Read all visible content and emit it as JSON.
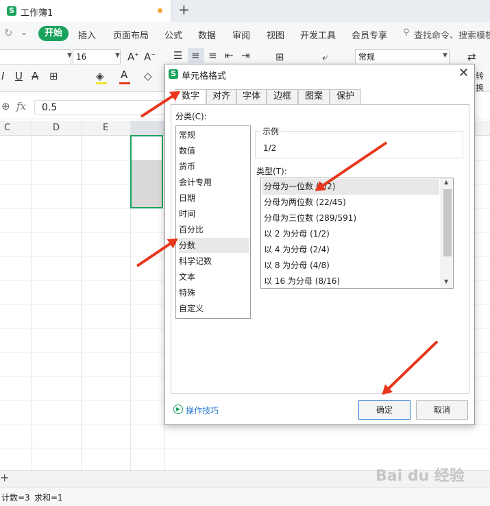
{
  "app": {
    "doc_title": "工作簿1",
    "logo_letter": "S"
  },
  "menu": {
    "start": "开始",
    "items": [
      "插入",
      "页面布局",
      "公式",
      "数据",
      "审阅",
      "视图",
      "开发工具",
      "会员专享"
    ],
    "search_placeholder": "查找命令、搜索模板"
  },
  "ribbon": {
    "font_size": "16",
    "number_format": "常规",
    "convert_label": "转换"
  },
  "formula_bar": {
    "fx": "fx",
    "value": "0.5"
  },
  "sheet": {
    "columns": [
      "C",
      "D",
      "E"
    ]
  },
  "status": {
    "count_label": "计数=3",
    "sum_label": "求和=1"
  },
  "dialog": {
    "title": "单元格格式",
    "tabs": [
      "数字",
      "对齐",
      "字体",
      "边框",
      "图案",
      "保护"
    ],
    "active_tab": "数字",
    "category_label": "分类(C):",
    "categories": [
      "常规",
      "数值",
      "货币",
      "会计专用",
      "日期",
      "时间",
      "百分比",
      "分数",
      "科学记数",
      "文本",
      "特殊",
      "自定义"
    ],
    "selected_category": "分数",
    "sample_label": "示例",
    "sample_value": "1/2",
    "type_label": "类型(T):",
    "types": [
      "分母为一位数 (1/2)",
      "分母为两位数 (22/45)",
      "分母为三位数 (289/591)",
      "以 2 为分母 (1/2)",
      "以 4 为分母 (2/4)",
      "以 8 为分母 (4/8)",
      "以 16 为分母 (8/16)"
    ],
    "selected_type": "分母为一位数 (1/2)",
    "tips_label": "操作技巧",
    "ok_label": "确定",
    "cancel_label": "取消"
  },
  "watermark": "Bai du 经验",
  "colors": {
    "accent": "#1aa35c",
    "arrow": "#e8371d",
    "link": "#2a7ad5"
  }
}
